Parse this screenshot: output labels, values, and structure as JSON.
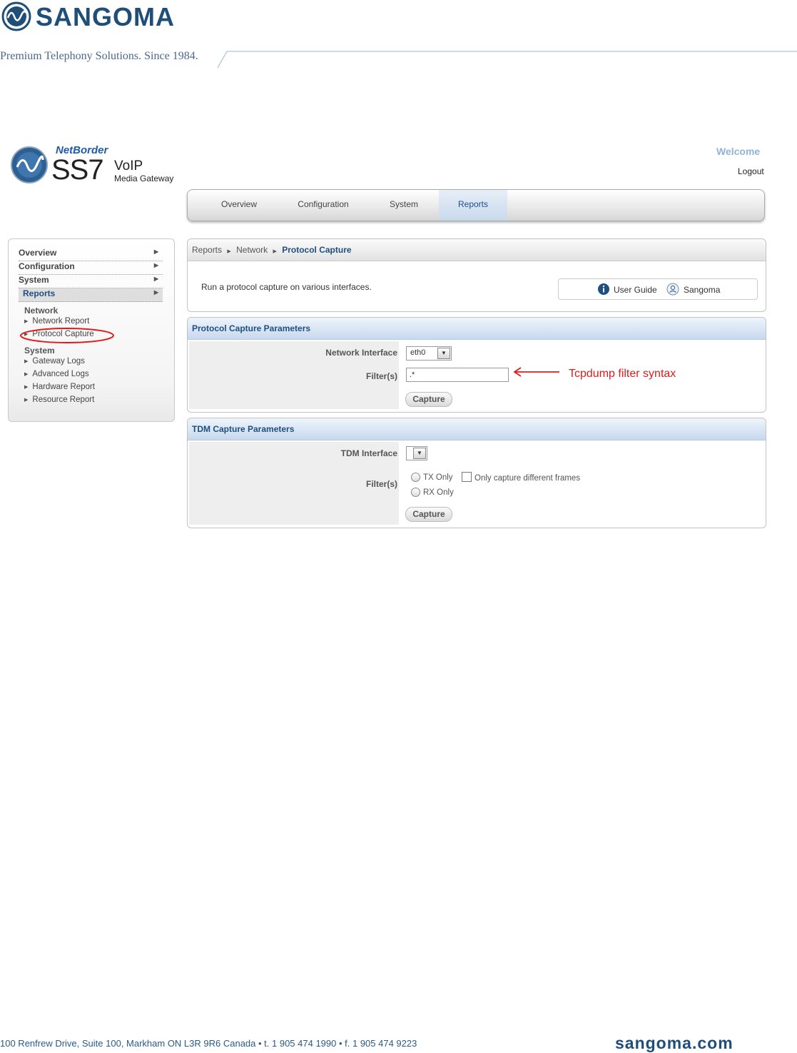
{
  "doc": {
    "brand": "SANGOMA",
    "tagline": "Premium Telephony Solutions. Since 1984.",
    "footer_address": "100 Renfrew Drive, Suite 100, Markham ON L3R 9R6 Canada  •  t. 1 905 474 1990  •  f. 1 905 474 9223",
    "footer_site": "sangoma.com"
  },
  "app": {
    "logo": {
      "netborder": "NetBorder",
      "ss7": "SS7",
      "voip": "VoIP",
      "media": "Media Gateway"
    },
    "welcome": "Welcome",
    "logout": "Logout",
    "nav": [
      "Overview",
      "Configuration",
      "System",
      "Reports"
    ],
    "nav_active": "Reports"
  },
  "sidebar": {
    "top_items": [
      "Overview",
      "Configuration",
      "System",
      "Reports"
    ],
    "network_heading": "Network",
    "network_links": [
      "Network Report",
      "Protocol Capture"
    ],
    "system_heading": "System",
    "system_links": [
      "Gateway Logs",
      "Advanced Logs",
      "Hardware Report",
      "Resource Report"
    ]
  },
  "breadcrumb": {
    "crumb1": "Reports",
    "crumb2": "Network",
    "current": "Protocol Capture"
  },
  "intro": {
    "description": "Run a protocol capture on various interfaces.",
    "user_guide": "User Guide",
    "sangoma": "Sangoma"
  },
  "protocol_panel": {
    "title": "Protocol Capture Parameters",
    "interface_label": "Network Interface",
    "interface_value": "eth0",
    "filter_label": "Filter(s)",
    "filter_value": ".*",
    "capture_label": "Capture"
  },
  "tdm_panel": {
    "title": "TDM Capture Parameters",
    "interface_label": "TDM Interface",
    "interface_value": "",
    "filter_label": "Filter(s)",
    "tx_only": "TX Only",
    "rx_only": "RX Only",
    "diff_frames": "Only capture different frames",
    "capture_label": "Capture"
  },
  "annotation": {
    "text": "Tcpdump filter syntax",
    "color": "#e01b1b"
  }
}
